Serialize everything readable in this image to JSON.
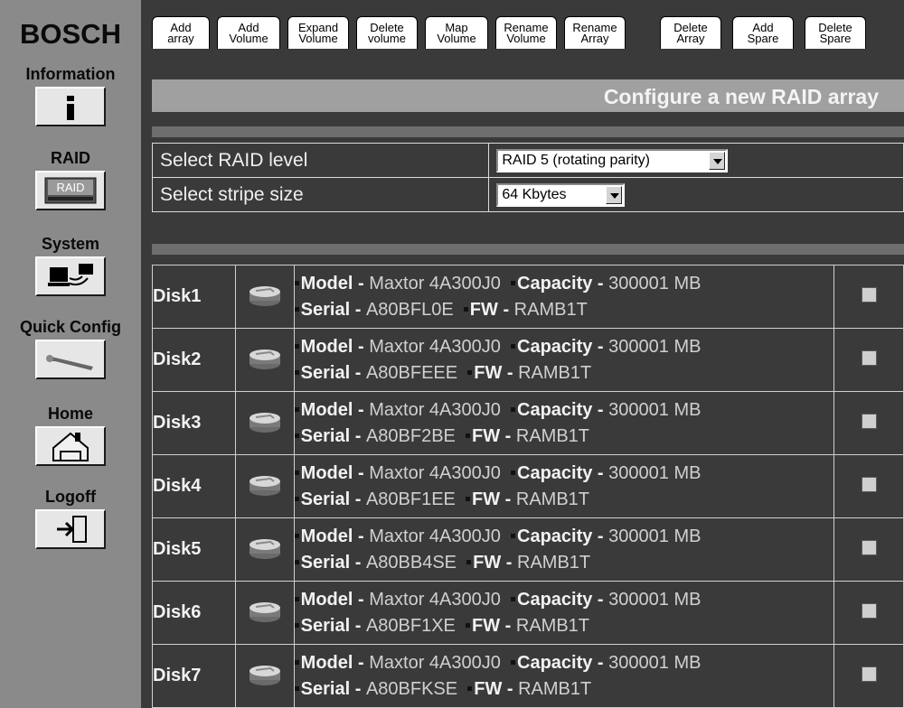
{
  "brand": "BOSCH",
  "nav": [
    {
      "label": "Information",
      "icon": "info-icon"
    },
    {
      "label": "RAID",
      "icon": "raid-icon",
      "icon_text": "RAID"
    },
    {
      "label": "System",
      "icon": "system-icon"
    },
    {
      "label": "Quick Config",
      "icon": "wrench-icon"
    },
    {
      "label": "Home",
      "icon": "home-icon"
    },
    {
      "label": "Logoff",
      "icon": "logoff-icon"
    }
  ],
  "tabs": [
    {
      "line1": "Add",
      "line2": "array"
    },
    {
      "line1": "Add",
      "line2": "Volume"
    },
    {
      "line1": "Expand",
      "line2": "Volume"
    },
    {
      "line1": "Delete",
      "line2": "volume"
    },
    {
      "line1": "Map",
      "line2": "Volume"
    },
    {
      "line1": "Rename",
      "line2": "Volume"
    },
    {
      "line1": "Rename",
      "line2": "Array"
    },
    {
      "line1": "Delete",
      "line2": "Array"
    },
    {
      "line1": "Add",
      "line2": "Spare"
    },
    {
      "line1": "Delete",
      "line2": "Spare"
    }
  ],
  "page_title": "Configure a new RAID array",
  "form": {
    "raid_level_label": "Select RAID level",
    "raid_level_value": "RAID 5 (rotating parity)",
    "stripe_label": "Select stripe size",
    "stripe_value": "64 Kbytes"
  },
  "field_labels": {
    "model": "Model",
    "capacity": "Capacity",
    "serial": "Serial",
    "fw": "FW",
    "sep": " - "
  },
  "disks": [
    {
      "name": "Disk1",
      "model": "Maxtor 4A300J0",
      "capacity": "300001 MB",
      "serial": "A80BFL0E",
      "fw": "RAMB1T"
    },
    {
      "name": "Disk2",
      "model": "Maxtor 4A300J0",
      "capacity": "300001 MB",
      "serial": "A80BFEEE",
      "fw": "RAMB1T"
    },
    {
      "name": "Disk3",
      "model": "Maxtor 4A300J0",
      "capacity": "300001 MB",
      "serial": "A80BF2BE",
      "fw": "RAMB1T"
    },
    {
      "name": "Disk4",
      "model": "Maxtor 4A300J0",
      "capacity": "300001 MB",
      "serial": "A80BF1EE",
      "fw": "RAMB1T"
    },
    {
      "name": "Disk5",
      "model": "Maxtor 4A300J0",
      "capacity": "300001 MB",
      "serial": "A80BB4SE",
      "fw": "RAMB1T"
    },
    {
      "name": "Disk6",
      "model": "Maxtor 4A300J0",
      "capacity": "300001 MB",
      "serial": "A80BF1XE",
      "fw": "RAMB1T"
    },
    {
      "name": "Disk7",
      "model": "Maxtor 4A300J0",
      "capacity": "300001 MB",
      "serial": "A80BFKSE",
      "fw": "RAMB1T"
    }
  ]
}
